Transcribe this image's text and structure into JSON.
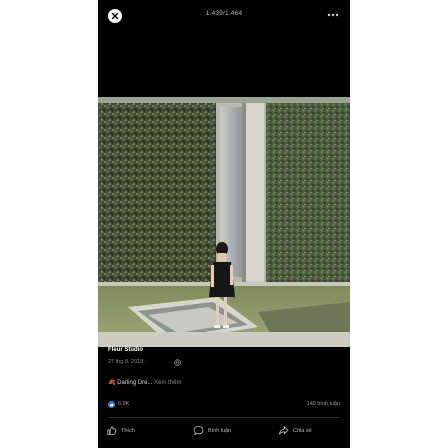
{
  "header": {
    "photo_counter": "1.439/1.464"
  },
  "post": {
    "page_name": "Fleur Studio",
    "date": "27 thg 8, 2018 · ",
    "caption_emoji": "🍂",
    "caption_text": " Darling Dre...",
    "see_more": " Xem thêm"
  },
  "stats": {
    "reactions": "6,9K",
    "comments": "149 bình luận"
  },
  "actions": {
    "like": "Thích",
    "comment": "Bình luận",
    "share": "Chia sẻ"
  },
  "colors": {
    "background": "#000000",
    "like_blue": "#2f6fe0",
    "text_muted": "#8a8a8a"
  }
}
